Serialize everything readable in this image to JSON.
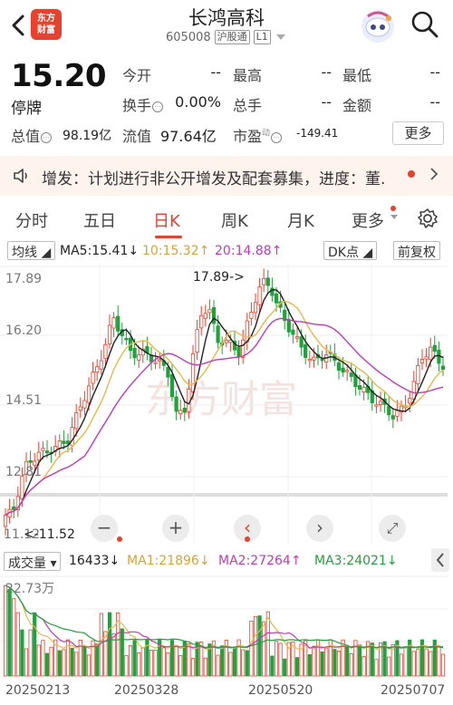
{
  "header": {
    "logo_line1": "东方",
    "logo_line2": "财富",
    "name": "长鸿高科",
    "code": "605008",
    "market_tag": "沪股通",
    "level_tag": "L1"
  },
  "quote": {
    "price": "15.20",
    "status": "停牌",
    "today_open_label": "今开",
    "today_open": "--",
    "high_label": "最高",
    "high": "--",
    "low_label": "最低",
    "low": "--",
    "turnover_label": "换手",
    "turnover": "0.00%",
    "volume_label": "总手",
    "volume": "--",
    "amount_label": "金额",
    "amount": "--",
    "total_cap_label": "总值",
    "total_cap": "98.19亿",
    "float_cap_label": "流值",
    "float_cap": "97.64亿",
    "pe_label": "市盈",
    "pe_sup": "动",
    "pe": "-149.41",
    "more_label": "更多"
  },
  "notice": {
    "text": "增发：计划进行非公开增发及配套募集，进度：董..."
  },
  "tabs": [
    "分时",
    "五日",
    "日K",
    "周K",
    "月K",
    "更多"
  ],
  "active_tab": "日K",
  "ma_bar": {
    "selector": "均线",
    "ma5": "MA5:15.41↓",
    "ma10": "10:15.32↑",
    "ma20": "20:14.88↑",
    "dk": "DK点",
    "adjust": "前复权"
  },
  "kline": {
    "y_ticks": [
      "17.89",
      "16.20",
      "14.51",
      "12.81",
      "11.12"
    ],
    "max_label": "17.89->",
    "min_label": "<-11.52",
    "watermark": "东方财富"
  },
  "volume_bar": {
    "selector": "成交量",
    "value": "16433↓",
    "ma1": "MA1:21896↓",
    "ma2": "MA2:27264↑",
    "ma3": "MA3:24021↓",
    "max_label": "22.73万"
  },
  "dates": [
    "20250213",
    "20250328",
    "20250520",
    "20250707"
  ],
  "colors": {
    "up": "#e8412e",
    "down": "#1fa33b",
    "ma5": "#222222",
    "ma10": "#e8b94a",
    "ma20": "#c23ab7",
    "accent": "#e8412e"
  }
}
